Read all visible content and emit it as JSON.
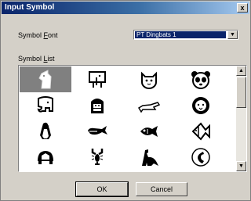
{
  "window": {
    "title": "Input Symbol",
    "close_glyph": "x"
  },
  "font_row": {
    "label_prefix": "Symbol ",
    "label_accel": "F",
    "label_suffix": "ont",
    "selected_font": "PT Dingbats 1"
  },
  "list": {
    "label_prefix": "Symbol ",
    "label_accel": "L",
    "label_suffix": "ist",
    "symbols": [
      "horse-head-icon",
      "elephant-sign-icon",
      "cat-face-icon",
      "panda-face-icon",
      "elephant-icon",
      "gorilla-icon",
      "crocodile-icon",
      "lion-face-icon",
      "penguin-icon",
      "whale-icon",
      "fish-icon",
      "angelfish-icon",
      "turtle-icon",
      "lobster-icon",
      "dinosaur-icon",
      "phone-icon"
    ],
    "selected_index": 0
  },
  "buttons": {
    "ok": "OK",
    "cancel": "Cancel"
  }
}
